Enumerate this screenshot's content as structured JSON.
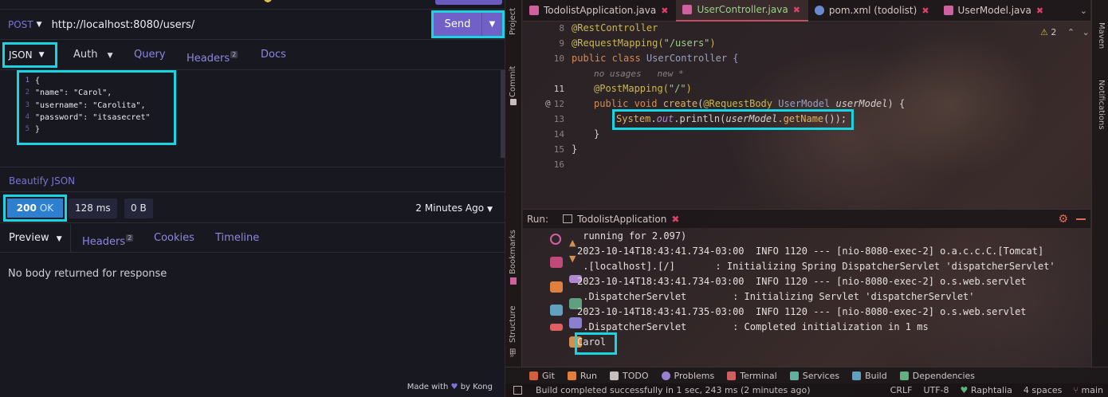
{
  "insomnia": {
    "request": {
      "method": "POST",
      "url": "http://localhost:8080/users/",
      "send_label": "Send"
    },
    "request_tabs": {
      "body_type": "JSON",
      "auth": "Auth",
      "query": "Query",
      "headers": "Headers",
      "headers_count": "2",
      "docs": "Docs"
    },
    "body_lines": [
      {
        "n": "1",
        "text": "{"
      },
      {
        "n": "2",
        "text": "\"name\": \"Carol\","
      },
      {
        "n": "3",
        "text": "\"username\": \"Carolita\","
      },
      {
        "n": "4",
        "text": "\"password\": \"itsasecret\""
      },
      {
        "n": "5",
        "text": "}"
      }
    ],
    "beautify_label": "Beautify JSON",
    "response": {
      "status_code": "200",
      "status_text": "OK",
      "time": "128 ms",
      "size": "0 B",
      "when": "2 Minutes Ago"
    },
    "response_tabs": {
      "preview": "Preview",
      "headers": "Headers",
      "headers_count": "2",
      "cookies": "Cookies",
      "timeline": "Timeline"
    },
    "empty_message": "No body returned for response",
    "footer": {
      "made_with": "Made with",
      "by": "by Kong"
    }
  },
  "ide": {
    "left_tools": [
      "Project",
      "Commit",
      "Bookmarks",
      "Structure"
    ],
    "right_tools": [
      "Maven",
      "Notifications"
    ],
    "tabs": [
      {
        "label": "TodolistApplication.java",
        "active": false,
        "color": "#d060a0"
      },
      {
        "label": "UserController.java",
        "active": true,
        "color": "#d060a0"
      },
      {
        "label": "pom.xml (todolist)",
        "active": false,
        "color": "#6a8ad0"
      },
      {
        "label": "UserModel.java",
        "active": false,
        "color": "#d060a0"
      }
    ],
    "warning_count": "2",
    "line_numbers": [
      "8",
      "9",
      "10",
      "",
      "11",
      "12",
      "13",
      "14",
      "15",
      "16"
    ],
    "code": {
      "l8": "@RestController",
      "l9_ann": "@RequestMapping(",
      "l9_str": "\"/users\"",
      "l9_end": ")",
      "l10_kw": "public class ",
      "l10_cls": "UserController {",
      "hint": "no usages   new *",
      "l11_ann": "@PostMapping(",
      "l11_str": "\"/\"",
      "l11_end": ")",
      "l12_kw": "public void ",
      "l12_fn": "create",
      "l12_p1": "(",
      "l12_ann": "@RequestBody ",
      "l12_cls": "UserModel ",
      "l12_var": "userModel",
      "l12_end": ") {",
      "l13_cls": "System",
      "l13_dot": ".",
      "l13_fld": "out",
      "l13_m": ".println(",
      "l13_var": "userModel",
      "l13_fn": ".getName",
      "l13_end": "());",
      "l14": "}",
      "l15": "}"
    },
    "run": {
      "label": "Run:",
      "tab": "TodolistApplication",
      "lines": [
        " running for 2.097)",
        "2023-10-14T18:43:41.734-03:00  INFO 1120 --- [nio-8080-exec-2] o.a.c.c.C.[Tomcat]",
        " .[localhost].[/]       : Initializing Spring DispatcherServlet 'dispatcherServlet'",
        "2023-10-14T18:43:41.734-03:00  INFO 1120 --- [nio-8080-exec-2] o.s.web.servlet",
        " .DispatcherServlet        : Initializing Servlet 'dispatcherServlet'",
        "2023-10-14T18:43:41.735-03:00  INFO 1120 --- [nio-8080-exec-2] o.s.web.servlet",
        " .DispatcherServlet        : Completed initialization in 1 ms",
        "Carol"
      ]
    },
    "bottom_tools": [
      {
        "label": "Git",
        "color": "#d06040"
      },
      {
        "label": "Run",
        "color": "#e08040"
      },
      {
        "label": "TODO",
        "color": "#c8bebd"
      },
      {
        "label": "Problems",
        "color": "#9a80d0"
      },
      {
        "label": "Terminal",
        "color": "#d06060"
      },
      {
        "label": "Services",
        "color": "#60b0a0"
      },
      {
        "label": "Build",
        "color": "#60a0c0"
      },
      {
        "label": "Dependencies",
        "color": "#60b080"
      }
    ],
    "status": {
      "message": "Build completed successfully in 1 sec, 243 ms (2 minutes ago)",
      "crlf": "CRLF",
      "encoding": "UTF-8",
      "user": "Raphtalia",
      "indent": "4 spaces",
      "branch": "main"
    }
  }
}
